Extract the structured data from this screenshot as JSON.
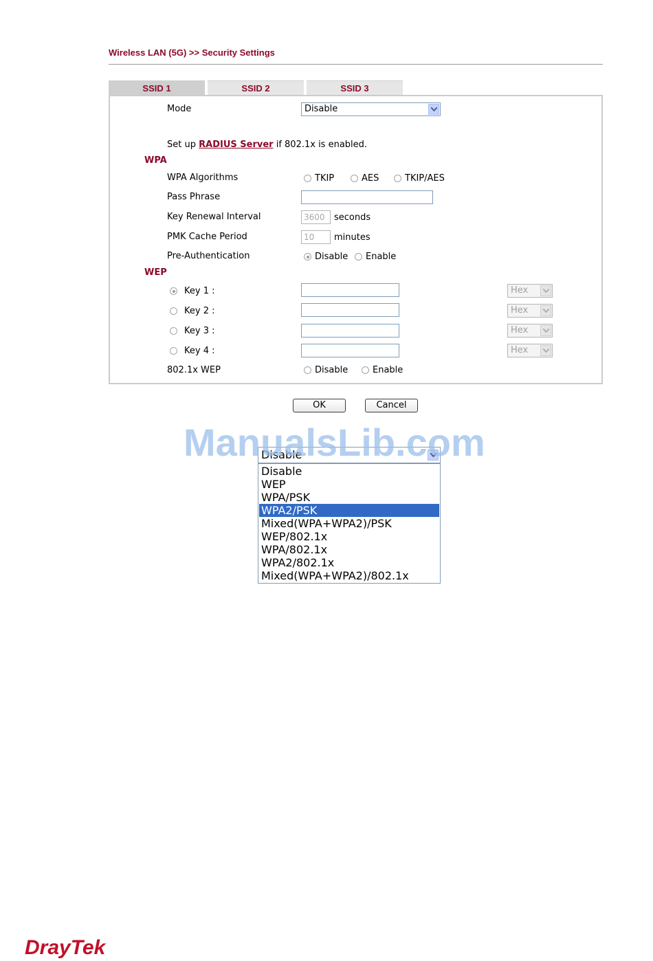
{
  "header": {
    "title": "Wireless LAN (5G) >> Security Settings"
  },
  "tabs": [
    {
      "label": "SSID 1"
    },
    {
      "label": "SSID 2"
    },
    {
      "label": "SSID 3"
    }
  ],
  "form": {
    "mode_label": "Mode",
    "mode_value": "Disable",
    "radius_prefix": "Set up",
    "radius_link": "RADIUS Server",
    "radius_suffix": "if 802.1x is enabled.",
    "wpa_section": "WPA",
    "wpa_algorithms_label": "WPA Algorithms",
    "wpa_algorithms_options": [
      "TKIP",
      "AES",
      "TKIP/AES"
    ],
    "pass_phrase_label": "Pass Phrase",
    "pass_phrase_value": "",
    "key_renewal_label": "Key Renewal Interval",
    "key_renewal_value": "3600",
    "key_renewal_unit": "seconds",
    "pmk_cache_label": "PMK Cache Period",
    "pmk_cache_value": "10",
    "pmk_cache_unit": "minutes",
    "preauth_label": "Pre-Authentication",
    "preauth_options": [
      "Disable",
      "Enable"
    ],
    "wep_section": "WEP",
    "keys": [
      {
        "label": "Key  1 :",
        "value": "",
        "format": "Hex"
      },
      {
        "label": "Key  2 :",
        "value": "",
        "format": "Hex"
      },
      {
        "label": "Key  3 :",
        "value": "",
        "format": "Hex"
      },
      {
        "label": "Key  4 :",
        "value": "",
        "format": "Hex"
      }
    ],
    "wep8021x_label": "802.1x WEP",
    "wep8021x_options": [
      "Disable",
      "Enable"
    ]
  },
  "buttons": {
    "ok": "OK",
    "cancel": "Cancel"
  },
  "dropdown": {
    "current": "Disable",
    "options": [
      "Disable",
      "WEP",
      "WPA/PSK",
      "WPA2/PSK",
      "Mixed(WPA+WPA2)/PSK",
      "WEP/802.1x",
      "WPA/802.1x",
      "WPA2/802.1x",
      "Mixed(WPA+WPA2)/802.1x"
    ],
    "highlighted": "WPA2/PSK"
  },
  "watermark": "ManualsLib.com",
  "brand": {
    "logo_text": "DrayTek",
    "color": "#c0102a"
  },
  "colors": {
    "accent": "#8b0a2a",
    "selection": "#316ac5"
  }
}
